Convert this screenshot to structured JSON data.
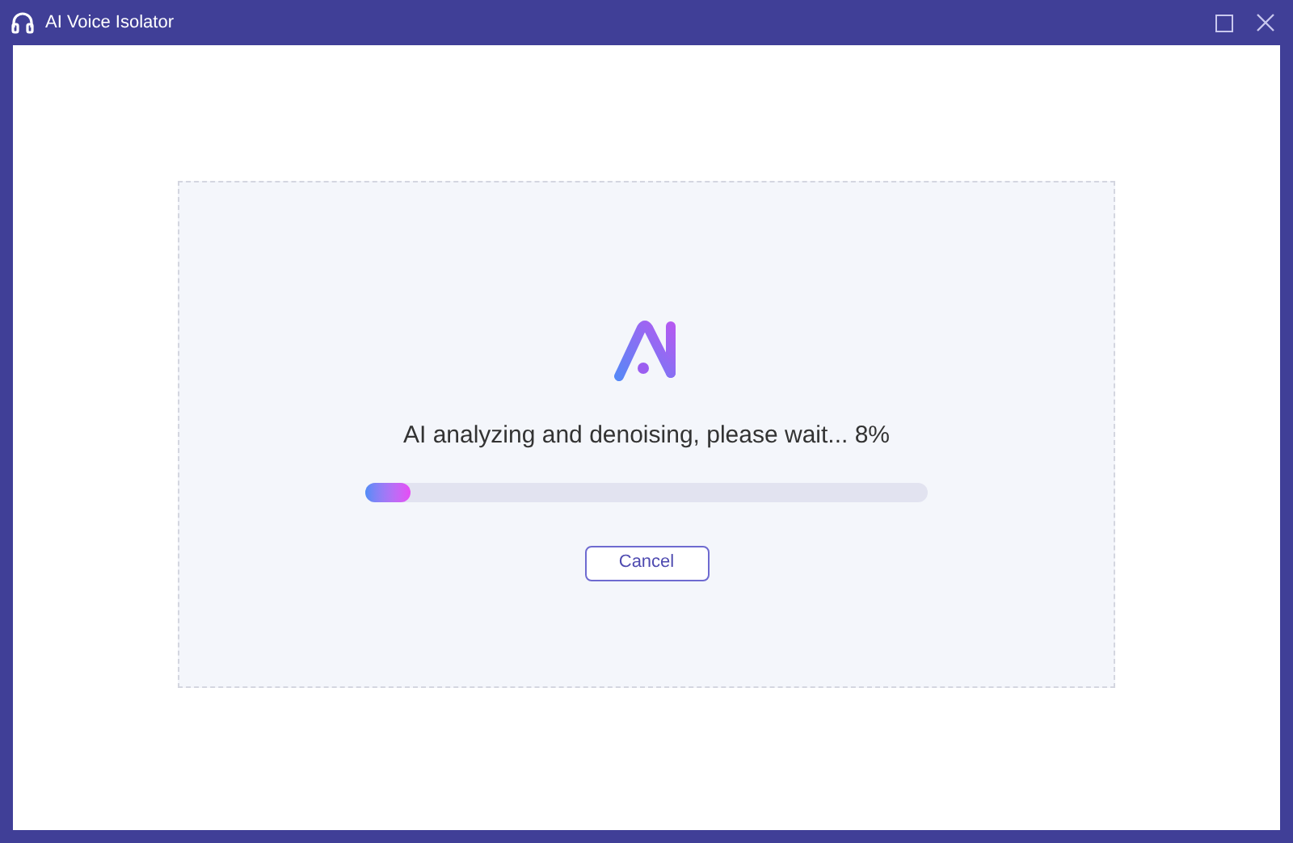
{
  "window": {
    "title": "AI Voice Isolator"
  },
  "progress": {
    "message": "AI analyzing and denoising, please wait... 8%",
    "level": 0.08
  },
  "buttons": [
    {
      "label": "Cancel"
    }
  ]
}
